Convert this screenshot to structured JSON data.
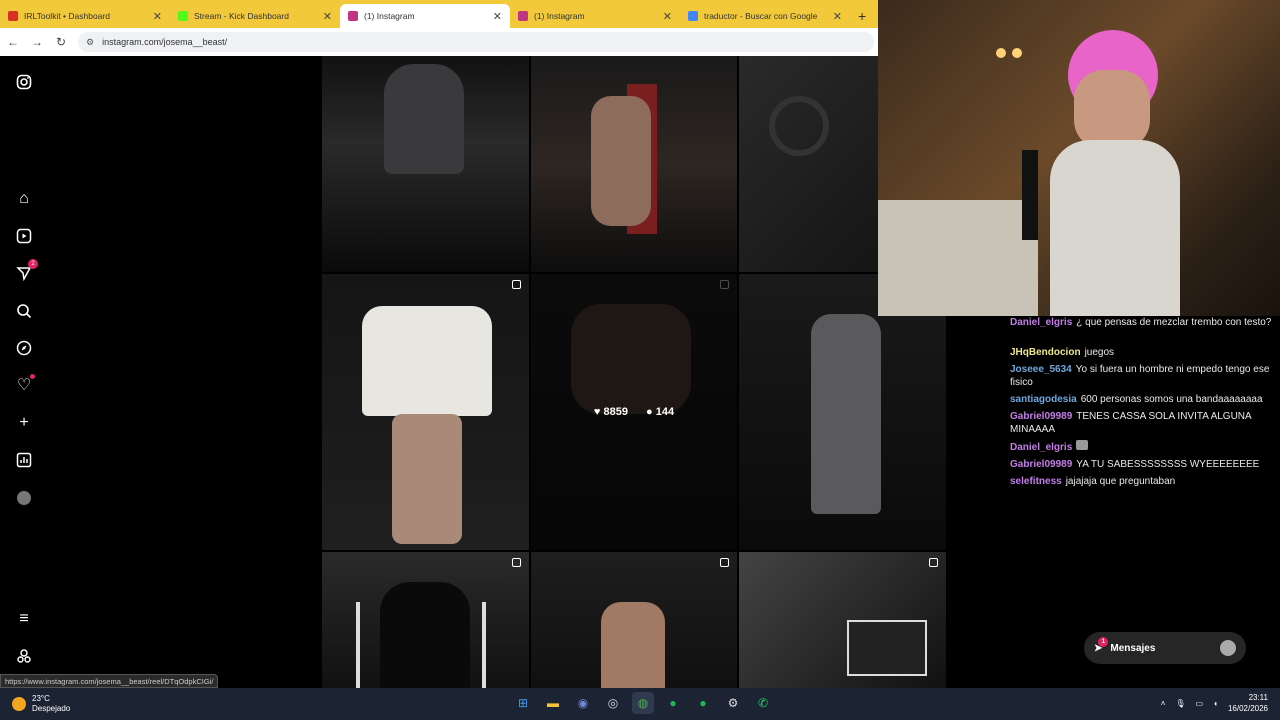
{
  "browser": {
    "tabs": [
      {
        "title": "IRLToolkit • Dashboard",
        "color": "#d93025"
      },
      {
        "title": "Stream - Kick Dashboard",
        "color": "#53fc18"
      },
      {
        "title": "(1) Instagram",
        "color": "#c13584"
      },
      {
        "title": "(1) Instagram",
        "color": "#c13584"
      },
      {
        "title": "traductor - Buscar con Google",
        "color": "#4285f4"
      }
    ],
    "url": "instagram.com/josema__beast/",
    "status_url": "https://www.instagram.com/josema__beast/reel/DTqOdpkCIGi/"
  },
  "sidebar": {
    "icons": [
      "instagram-icon",
      "home-icon",
      "reels-icon",
      "messenger-icon",
      "search-icon",
      "explore-icon",
      "heart-icon",
      "create-icon",
      "dashboard-icon",
      "profile-avatar"
    ],
    "messenger_badge": "2",
    "bottom": [
      "menu-icon",
      "threads-icon"
    ]
  },
  "grid": {
    "hover_likes": "8859",
    "hover_comments": "144"
  },
  "chat": {
    "messages": [
      {
        "user": "Daniel_elgris",
        "text": "¿ que pensas de mezclar trembo con testo?",
        "color": "#c37ee8"
      },
      {
        "user": "JHqBendocion",
        "text": "juegos",
        "color": "#f0e68c"
      },
      {
        "user": "Joseee_5634",
        "text": "Yo si fuera un hombre ni empedo tengo ese fisico",
        "color": "#6fa8dc"
      },
      {
        "user": "santiagodesia",
        "text": "600 personas somos una bandaaaaaaaa",
        "color": "#6fa8dc"
      },
      {
        "user": "Gabriel09989",
        "text": "TENES CASSA SOLA INVITA ALGUNA MINAAAA",
        "color": "#c37ee8"
      },
      {
        "user": "Daniel_elgris",
        "text": "",
        "color": "#c37ee8"
      },
      {
        "user": "Gabriel09989",
        "text": "YA TU SABESSSSSSSS WYEEEEEEEE",
        "color": "#c37ee8"
      },
      {
        "user": "selefitness",
        "text": "jajajaja que preguntaban",
        "color": "#c37ee8"
      }
    ]
  },
  "messages_button": {
    "label": "Mensajes",
    "badge": "1"
  },
  "taskbar": {
    "temp": "23°C",
    "weather": "Despejado",
    "time": "23:11",
    "date": "16/02/2026"
  }
}
